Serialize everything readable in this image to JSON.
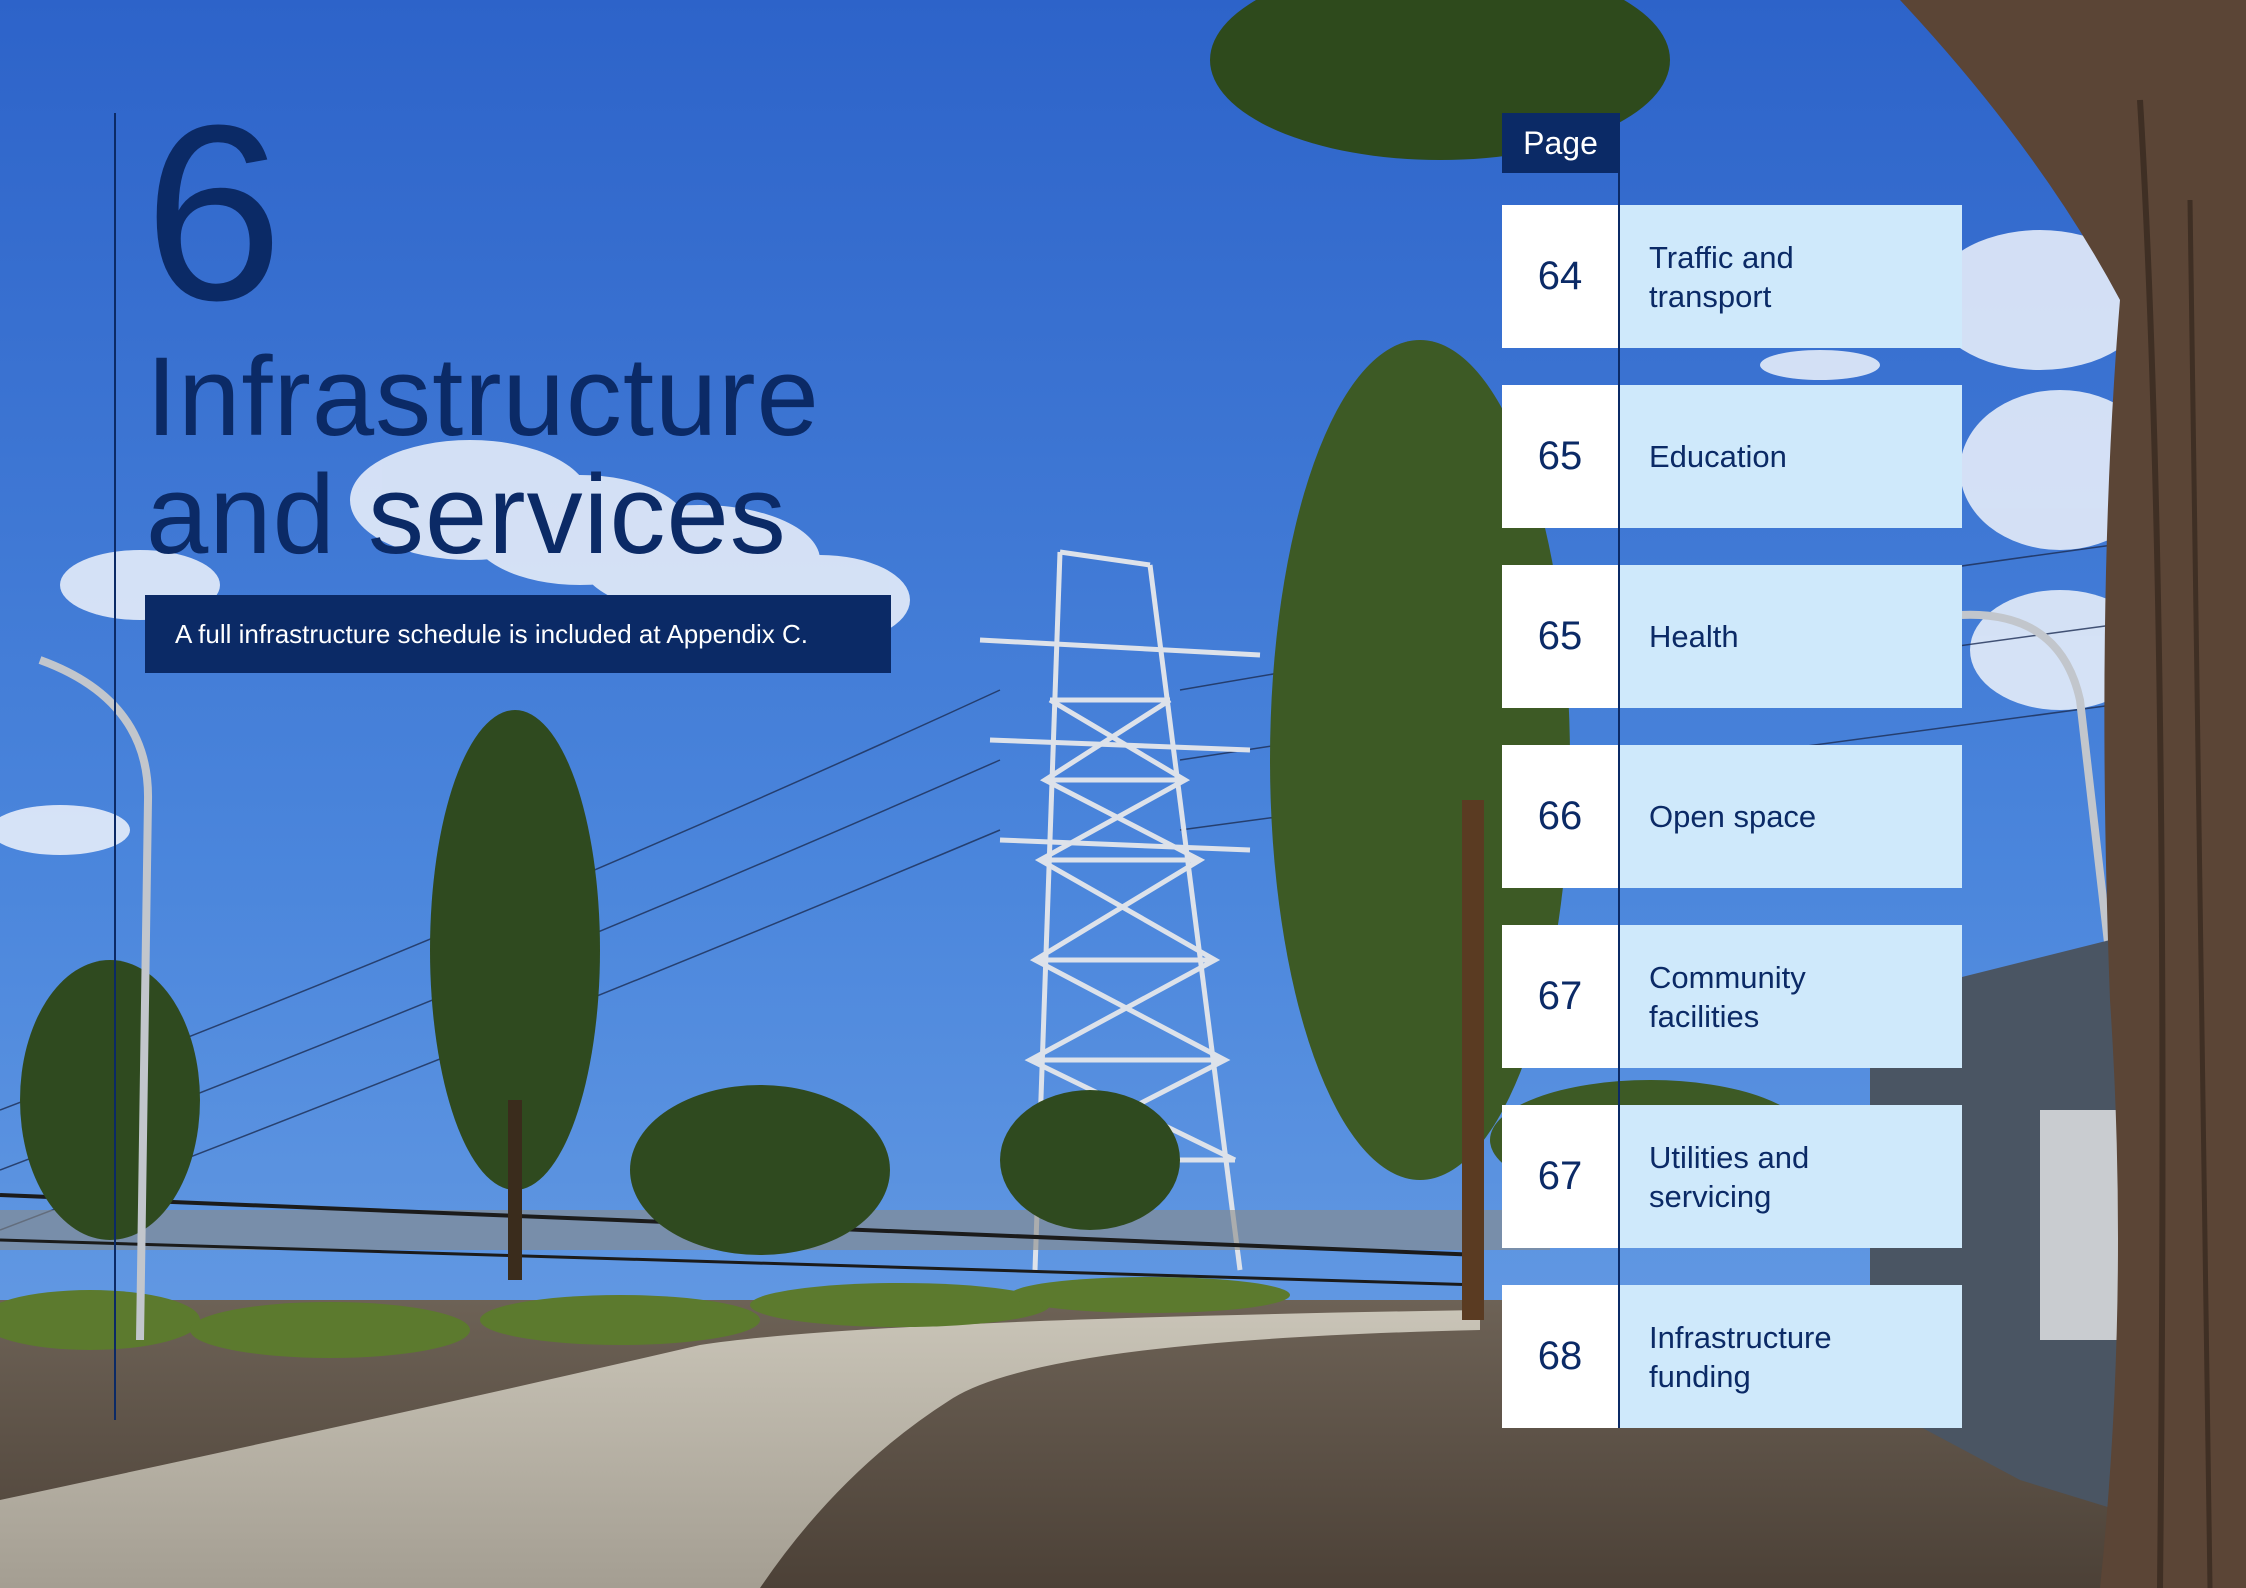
{
  "chapter": {
    "number": "6",
    "title_line1": "Infrastructure",
    "title_line2": "and services",
    "note": "A full infrastructure schedule is included at Appendix C."
  },
  "toc": {
    "header": "Page",
    "items": [
      {
        "page": "64",
        "label": "Traffic and transport"
      },
      {
        "page": "65",
        "label": "Education"
      },
      {
        "page": "65",
        "label": "Health"
      },
      {
        "page": "66",
        "label": "Open space"
      },
      {
        "page": "67",
        "label": "Community facilities"
      },
      {
        "page": "67",
        "label": "Utilities and servicing"
      },
      {
        "page": "68",
        "label": "Infrastructure funding"
      }
    ]
  },
  "colors": {
    "navy": "#0b2a66",
    "light_blue": "#cfe9fb",
    "white": "#ffffff"
  }
}
